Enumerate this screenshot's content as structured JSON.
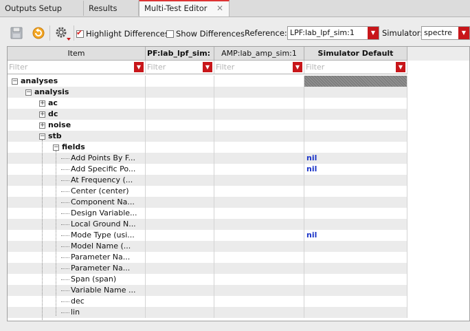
{
  "tabs": [
    {
      "label": "Outputs Setup"
    },
    {
      "label": "Results"
    },
    {
      "label": "Multi-Test Editor",
      "close": "✕"
    }
  ],
  "toolbar": {
    "highlight_label": "Highlight Differences",
    "highlight_checked": true,
    "show_label": "Show Differences",
    "show_checked": false,
    "reference_label": "Reference:",
    "reference_value": "LPF:lab_lpf_sim:1",
    "simulator_label": "Simulator:",
    "simulator_value": "spectre"
  },
  "table": {
    "columns": [
      {
        "label": "Item"
      },
      {
        "label": "PF:lab_lpf_sim:"
      },
      {
        "label": "AMP:lab_amp_sim:1"
      },
      {
        "label": "Simulator Default"
      }
    ],
    "filter_placeholder": "Filter",
    "rows": [
      {
        "label": "analyses",
        "bold": true,
        "expander": "−",
        "sim_default": ""
      },
      {
        "label": "analysis",
        "bold": true,
        "expander": "−",
        "sim_default": ""
      },
      {
        "label": "ac",
        "bold": true,
        "expander": "+",
        "sim_default": ""
      },
      {
        "label": "dc",
        "bold": true,
        "expander": "+",
        "sim_default": ""
      },
      {
        "label": "noise",
        "bold": true,
        "expander": "+",
        "sim_default": ""
      },
      {
        "label": "stb",
        "bold": true,
        "expander": "−",
        "sim_default": ""
      },
      {
        "label": "fields",
        "bold": true,
        "expander": "−",
        "sim_default": ""
      },
      {
        "label": "Add Points By F...",
        "bold": false,
        "sim_default": "nil"
      },
      {
        "label": "Add Specific Po...",
        "bold": false,
        "sim_default": "nil"
      },
      {
        "label": "At Frequency (...",
        "bold": false,
        "sim_default": ""
      },
      {
        "label": "Center (center)",
        "bold": false,
        "sim_default": ""
      },
      {
        "label": "Component Na...",
        "bold": false,
        "sim_default": ""
      },
      {
        "label": "Design Variable...",
        "bold": false,
        "sim_default": ""
      },
      {
        "label": "Local Ground N...",
        "bold": false,
        "sim_default": ""
      },
      {
        "label": "Mode Type (usi...",
        "bold": false,
        "sim_default": "nil"
      },
      {
        "label": "Model Name (...",
        "bold": false,
        "sim_default": ""
      },
      {
        "label": "Parameter Na...",
        "bold": false,
        "sim_default": ""
      },
      {
        "label": "Parameter Na...",
        "bold": false,
        "sim_default": ""
      },
      {
        "label": "Span (span)",
        "bold": false,
        "sim_default": ""
      },
      {
        "label": "Variable Name ...",
        "bold": false,
        "sim_default": ""
      },
      {
        "label": "dec",
        "bold": false,
        "sim_default": ""
      },
      {
        "label": "lin",
        "bold": false,
        "sim_default": ""
      }
    ]
  },
  "icons": {
    "save": "save-icon",
    "refresh": "refresh-icon",
    "settings": "gear-icon"
  },
  "colors": {
    "accent": "#c8161a",
    "nil_text": "#1c35c8"
  }
}
